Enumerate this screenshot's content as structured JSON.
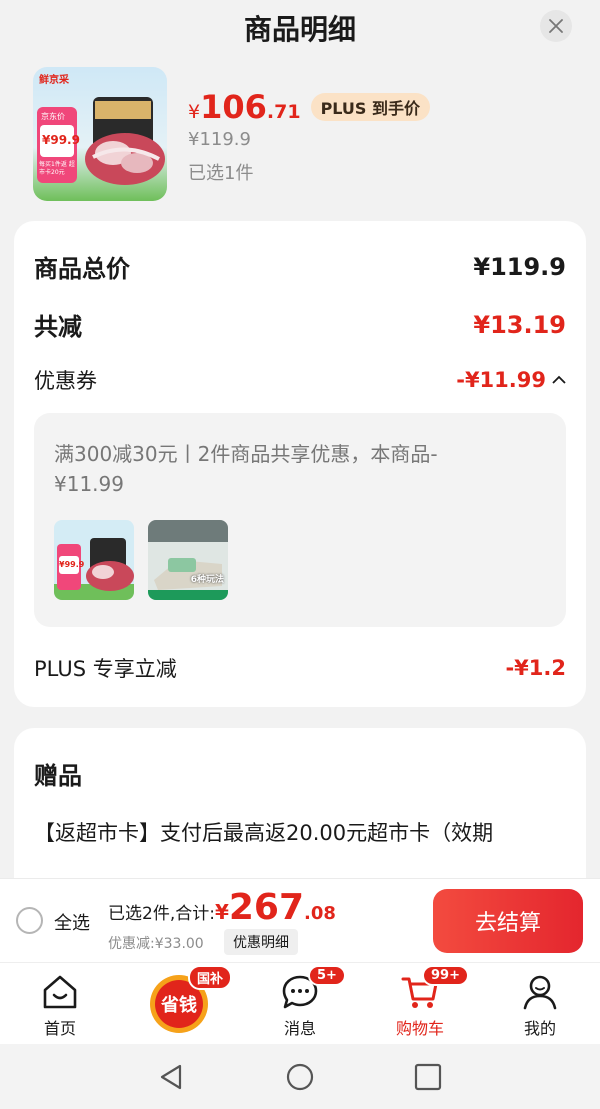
{
  "header": {
    "title": "商品明细",
    "close_icon": "close-icon"
  },
  "product": {
    "image_label": "鲜京采",
    "image_brand": "京东价",
    "image_price": "¥99.9",
    "image_note": "每买1件返 超市卡20元",
    "currency": "¥",
    "price_int": "106",
    "price_dec": ".71",
    "plus_tag": "PLUS 到手价",
    "original_price": "¥119.9",
    "selected_count": "已选1件"
  },
  "summary": {
    "total_label": "商品总价",
    "total_value": "¥119.9",
    "reduced_label": "共减",
    "reduced_value": "¥13.19",
    "coupon_label": "优惠券",
    "coupon_value": "-¥11.99",
    "coupon_desc": "满300减30元丨2件商品共享优惠，本商品-¥11.99",
    "thumb2_text": "6种玩法",
    "plus_label": "PLUS 专享立减",
    "plus_value": "-¥1.2"
  },
  "gift": {
    "title": "赠品",
    "desc": "【返超市卡】支付后最高返20.00元超市卡（效期"
  },
  "checkout": {
    "select_all": "全选",
    "summary_label": "已选2件,合计:",
    "currency": "¥",
    "total_int": "267",
    "total_dec": ".08",
    "discount": "优惠减:¥33.00",
    "discount_detail": "优惠明细",
    "pay_button": "去结算"
  },
  "tabs": [
    {
      "label": "首页",
      "icon": "home-icon"
    },
    {
      "label": "",
      "icon": "save-money-icon",
      "badge": "国补",
      "logo_text": "省钱"
    },
    {
      "label": "消息",
      "icon": "message-icon",
      "badge": "5+"
    },
    {
      "label": "购物车",
      "icon": "cart-icon",
      "badge": "99+"
    },
    {
      "label": "我的",
      "icon": "profile-icon"
    }
  ],
  "colors": {
    "accent": "#e1251b",
    "plus_tag_bg": "#fbe2c6"
  }
}
